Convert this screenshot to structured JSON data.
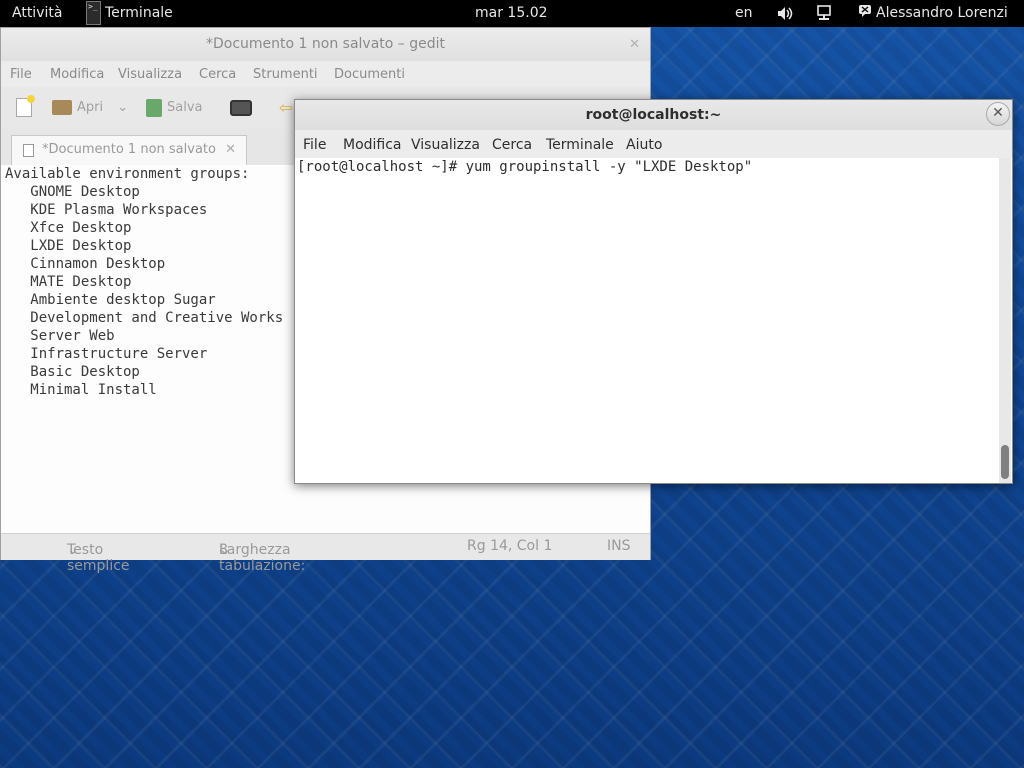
{
  "topbar": {
    "activities": "Attività",
    "app_name": "Terminale",
    "clock": "mar 15.02",
    "lang": "en",
    "user": "Alessandro Lorenzi"
  },
  "gedit": {
    "title": "*Documento 1 non salvato – gedit",
    "menu": [
      "File",
      "Modifica",
      "Visualizza",
      "Cerca",
      "Strumenti",
      "Documenti"
    ],
    "toolbar": {
      "open": "Apri",
      "save": "Salva"
    },
    "tab_label": "*Documento 1 non salvato",
    "lines": [
      "Available environment groups:",
      "   GNOME Desktop",
      "   KDE Plasma Workspaces",
      "   Xfce Desktop",
      "   LXDE Desktop",
      "   Cinnamon Desktop",
      "   MATE Desktop",
      "   Ambiente desktop Sugar",
      "   Development and Creative Works",
      "   Server Web",
      "   Infrastructure Server",
      "   Basic Desktop",
      "   Minimal Install"
    ],
    "status": {
      "language": "Testo semplice",
      "tab_width_label": "Larghezza tabulazione:",
      "tab_width_value": "8",
      "position": "Rg 14, Col 1",
      "mode": "INS"
    }
  },
  "terminal": {
    "title": "root@localhost:~",
    "menu": [
      "File",
      "Modifica",
      "Visualizza",
      "Cerca",
      "Terminale",
      "Aiuto"
    ],
    "prompt_line": "[root@localhost ~]# yum groupinstall -y \"LXDE Desktop\""
  }
}
